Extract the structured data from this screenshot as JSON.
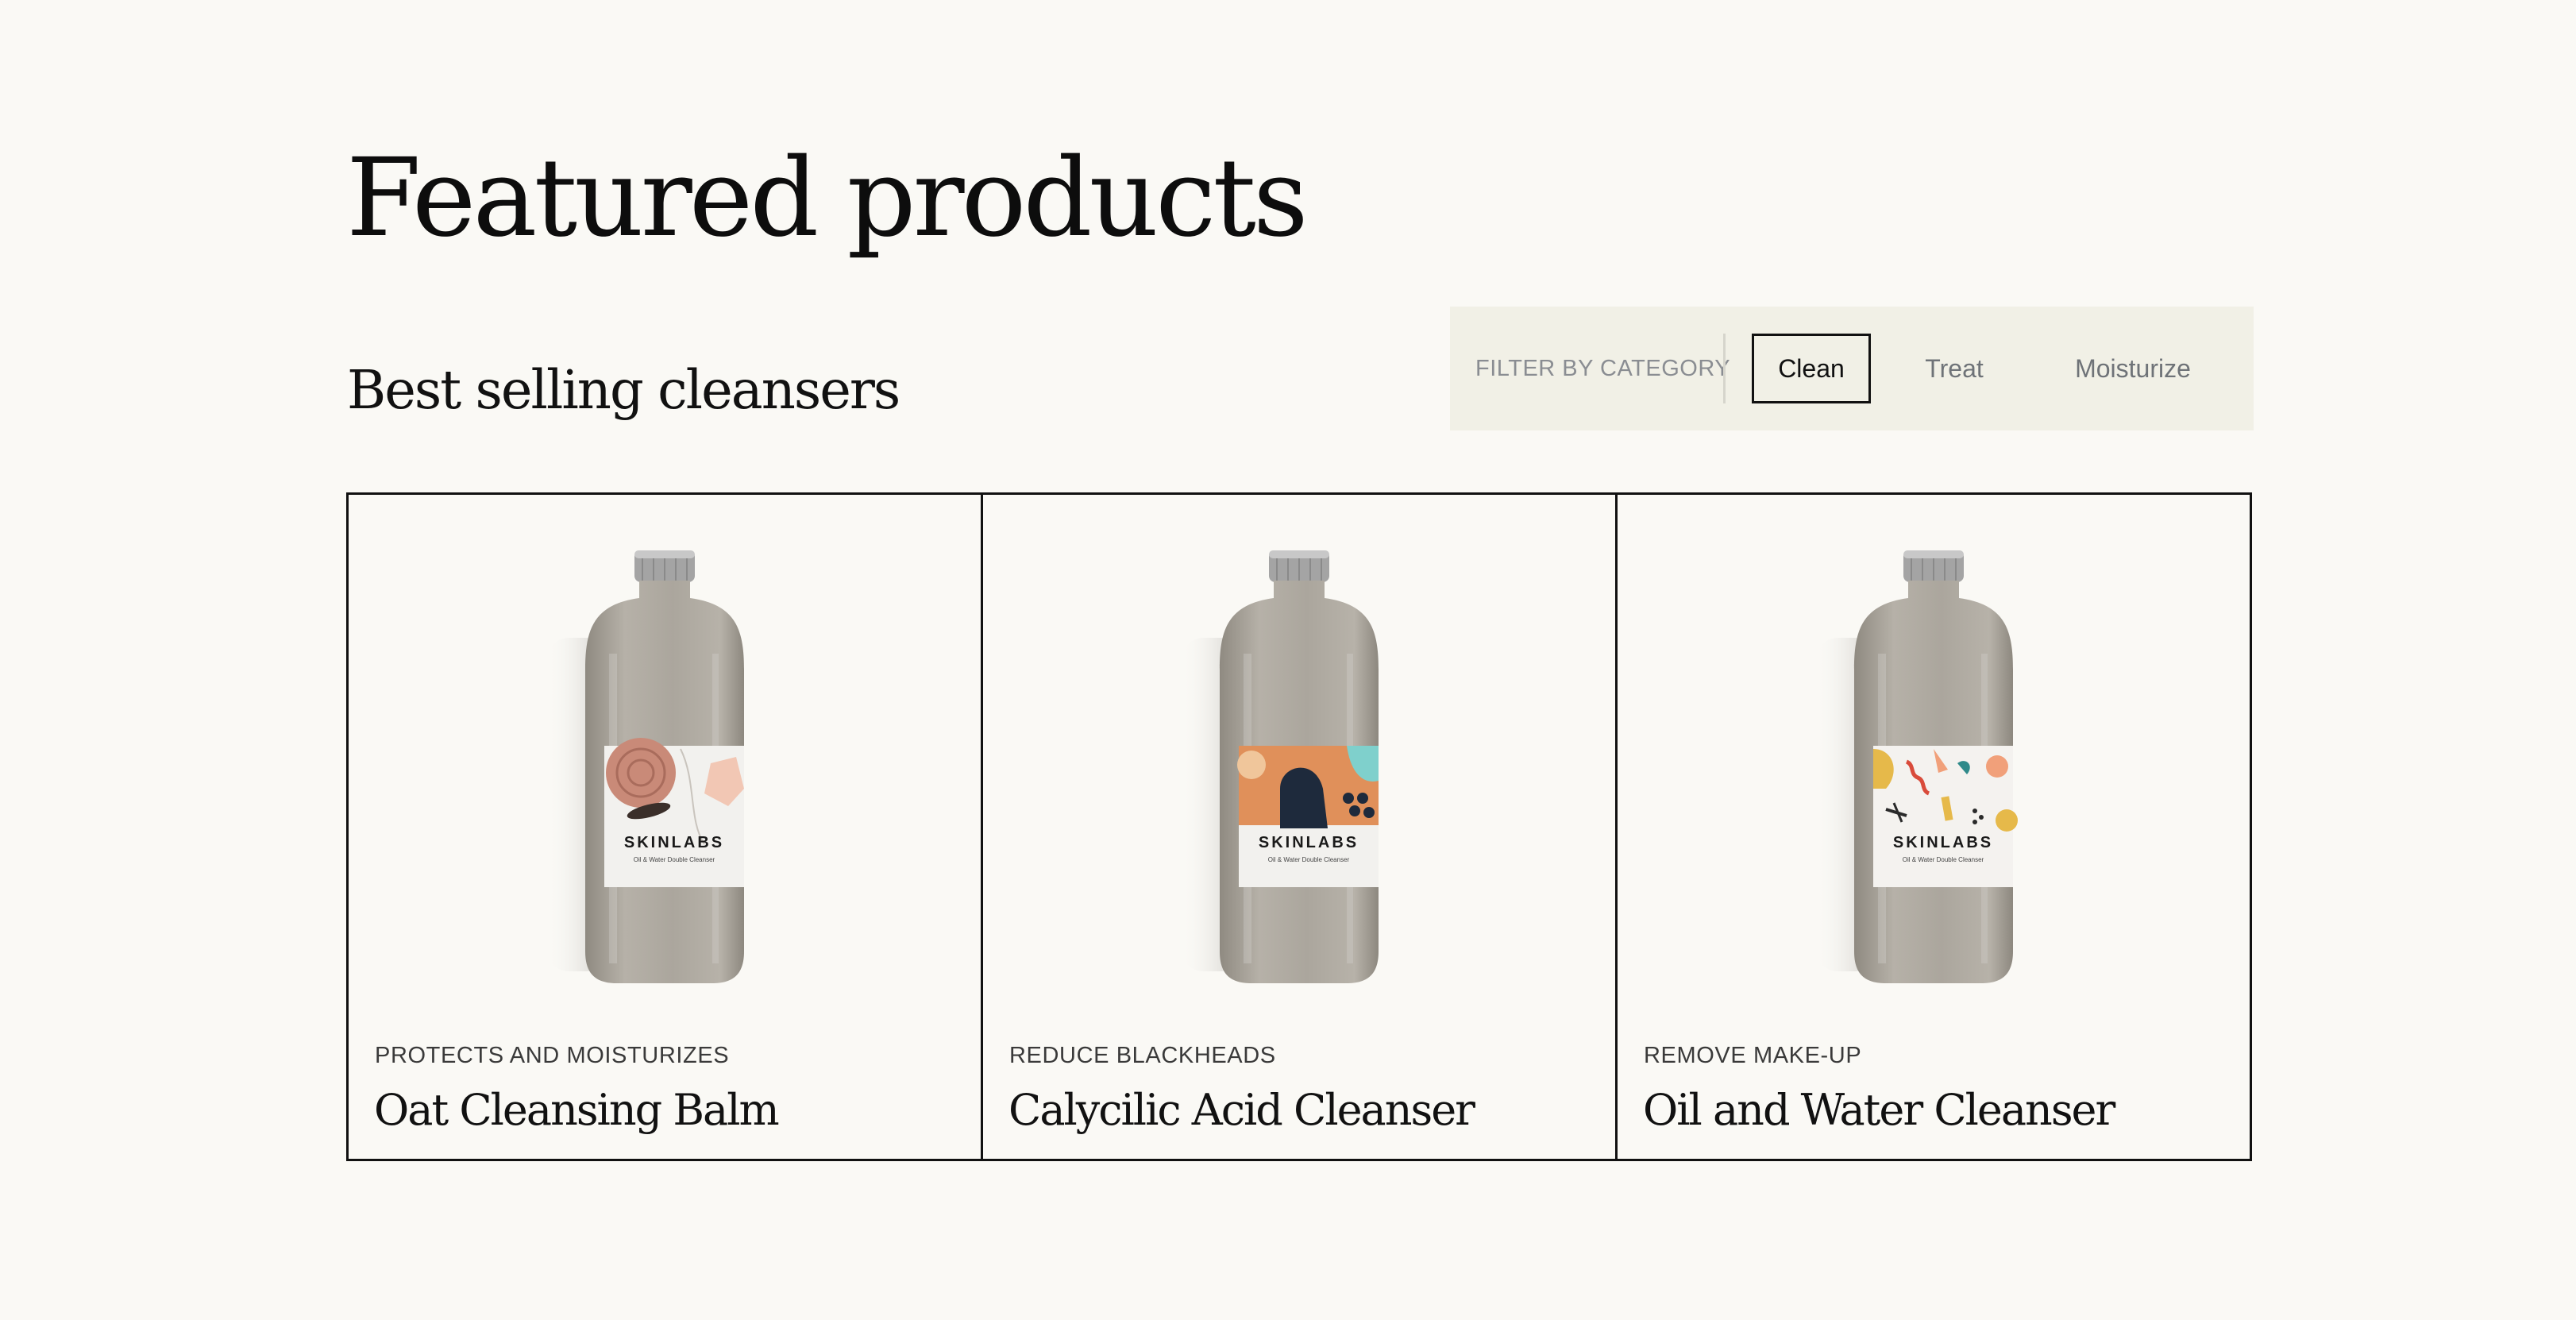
{
  "page": {
    "title": "Featured products",
    "subtitle": "Best selling cleansers"
  },
  "filter": {
    "label": "FILTER BY CATEGORY",
    "options": [
      {
        "label": "Clean",
        "selected": true
      },
      {
        "label": "Treat",
        "selected": false
      },
      {
        "label": "Moisturize",
        "selected": false
      }
    ]
  },
  "products": [
    {
      "tagline": "PROTECTS AND MOISTURIZES",
      "name": "Oat Cleansing Balm",
      "brand": "SKINLABS",
      "label_subtext": "Oil & Water Double Cleanser",
      "label_palette": [
        "#c98a78",
        "#3b2f2a",
        "#f2c7b4",
        "#e9e6e2"
      ]
    },
    {
      "tagline": "REDUCE BLACKHEADS",
      "name": "Calycilic Acid Cleanser",
      "brand": "SKINLABS",
      "label_subtext": "Oil & Water Double Cleanser",
      "label_palette": [
        "#e0905a",
        "#1e2a3c",
        "#7fd0cc",
        "#f0c69b"
      ]
    },
    {
      "tagline": "REMOVE MAKE-UP",
      "name": "Oil and Water Cleanser",
      "brand": "SKINLABS",
      "label_subtext": "Oil & Water Double Cleanser",
      "label_palette": [
        "#e6b94a",
        "#d94b3b",
        "#2f8a8a",
        "#f1a07a"
      ]
    }
  ],
  "colors": {
    "background": "#faf9f5",
    "filter_bar": "#f1f0e6",
    "border": "#111111",
    "muted_text": "#8a8d92",
    "bottle_body": "#b1aca3",
    "bottle_cap": "#a9a9a9"
  }
}
